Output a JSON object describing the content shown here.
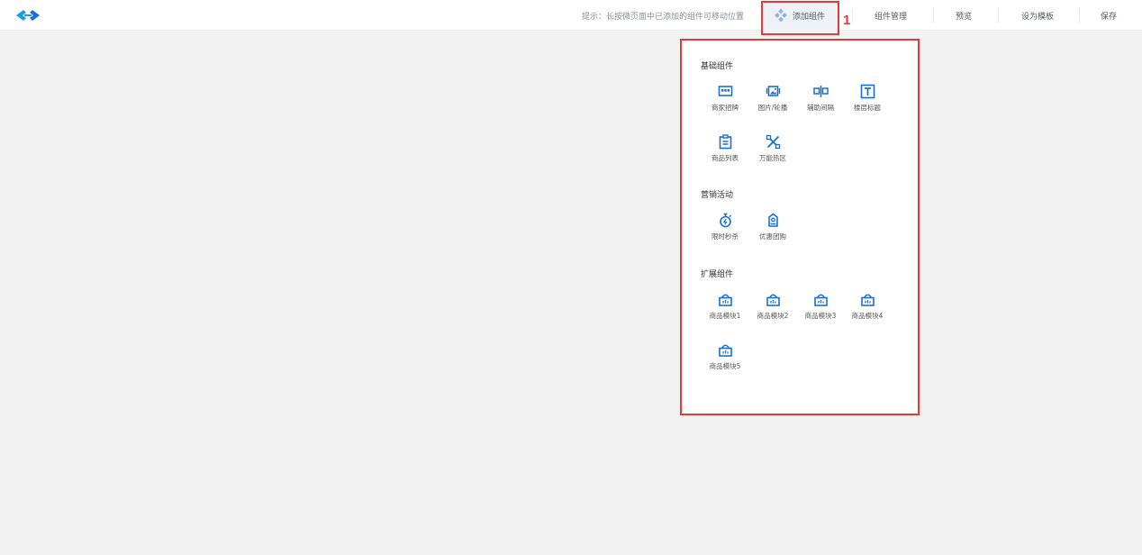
{
  "header": {
    "logo_icon": "double-chevron-logo",
    "hint": "提示：长按微页面中已添加的组件可移动位置",
    "add_component": "添加组件",
    "component_manage": "组件管理",
    "preview": "预览",
    "set_template": "设为模板",
    "save": "保存"
  },
  "annotation": {
    "step": "1",
    "color": "#e6393a"
  },
  "accent": "#1a6fd6",
  "panel": {
    "sections": [
      {
        "title": "基础组件",
        "items": [
          {
            "label": "商家招牌",
            "icon": "storefront-sign-icon"
          },
          {
            "label": "图片/轮播",
            "icon": "image-carousel-icon"
          },
          {
            "label": "辅助间隔",
            "icon": "spacer-icon"
          },
          {
            "label": "楼层标题",
            "icon": "title-text-icon"
          },
          {
            "label": "商品列表",
            "icon": "product-list-icon"
          },
          {
            "label": "万能热区",
            "icon": "hotspot-icon"
          }
        ]
      },
      {
        "title": "营销活动",
        "items": [
          {
            "label": "限时秒杀",
            "icon": "stopwatch-icon"
          },
          {
            "label": "优惠团购",
            "icon": "group-coupon-icon"
          }
        ]
      },
      {
        "title": "扩展组件",
        "items": [
          {
            "label": "商品模块1",
            "icon": "basket-icon"
          },
          {
            "label": "商品模块2",
            "icon": "basket-icon"
          },
          {
            "label": "商品模块3",
            "icon": "basket-icon"
          },
          {
            "label": "商品模块4",
            "icon": "basket-icon"
          },
          {
            "label": "商品模块5",
            "icon": "basket-icon"
          }
        ]
      }
    ]
  }
}
